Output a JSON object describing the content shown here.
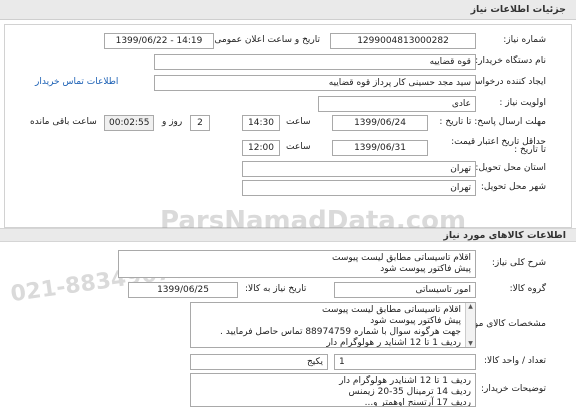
{
  "header": {
    "title": "جزئیات اطلاعات نیاز"
  },
  "fields": {
    "need_number_label": "شماره نیاز:",
    "need_number": "1299004813000282",
    "announce_label": "تاریخ و ساعت اعلان عمومی:",
    "announce_value": "1399/06/22 - 14:19",
    "buyer_label": "نام دستگاه خریدار:",
    "buyer": "قوه قضاییه",
    "requester_label": "ایجاد کننده درخواست:",
    "requester": "سید مجد حسینی کار پرداز  قوه قضاییه",
    "contact_link": "اطلاعات تماس خریدار",
    "priority_label": "اولویت نیاز :",
    "priority": "عادی",
    "reply_deadline_label": "مهلت ارسال پاسخ: تا تاریخ :",
    "reply_date": "1399/06/24",
    "time_label": "ساعت",
    "reply_time": "14:30",
    "days": "2",
    "day_label": "روز و",
    "remaining": "00:02:55",
    "remaining_label": "ساعت باقی مانده",
    "validity_label": "حداقل تاریخ اعتبار قیمت:",
    "validity_to_label": "تا تاریخ :",
    "validity_date": "1399/06/31",
    "validity_time": "12:00",
    "province_label": "استان محل تحویل:",
    "province": "تهران",
    "city_label": "شهر محل تحویل:",
    "city": "تهران"
  },
  "goods": {
    "section_title": "اطلاعات کالاهای مورد نیاز",
    "summary_label": "شرح کلی نیاز:",
    "summary_lines": [
      "اقلام تاسیساتی مطابق لیست پیوست",
      "پیش فاکتور پیوست شود"
    ],
    "group_label": "گروه کالا:",
    "group_value": "امور تاسیساتی",
    "need_date_label": "تاریخ نیاز به کالا:",
    "need_date": "1399/06/25",
    "spec_label": "مشخصات کالای مورد نیاز:",
    "spec_lines": [
      "اقلام تاسیساتی مطابق لیست پیوست",
      "پیش فاکتور پیوست شود",
      "جهت هرگونه سوال با شماره 88974759 تماس حاصل فرمایید .",
      "ردیف 1 تا 12 اشناید ر هولوگرام دار"
    ],
    "qty_label": "تعداد / واحد کالا:",
    "qty": "1",
    "unit": "یکیج",
    "notes_label": "توضیحات خریدار:",
    "notes_lines": [
      "ردیف 1 تا 12 اشنایدر هولوگرام دار",
      "ردیف 14 ترمینال 35-20 زیمنس",
      "ردیف 17 آرتسنج اوهمتر و..."
    ]
  },
  "watermark": {
    "text": "ParsNamadData.com",
    "phone": "021-88349670"
  }
}
